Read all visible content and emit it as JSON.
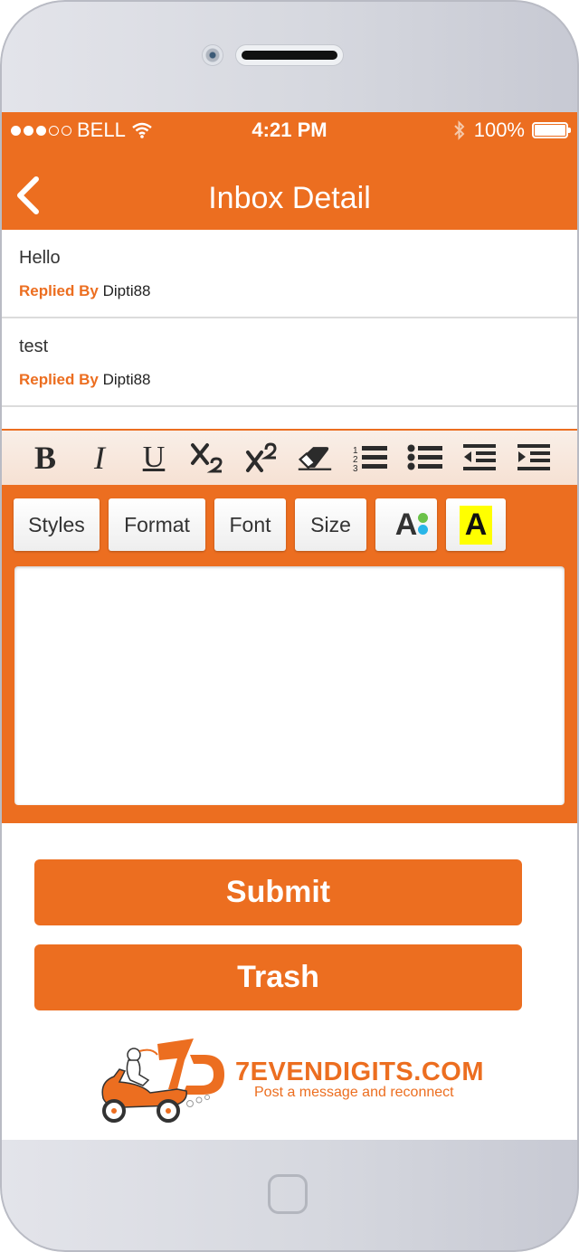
{
  "status": {
    "carrier": "BELL",
    "time": "4:21 PM",
    "battery": "100%"
  },
  "nav": {
    "title": "Inbox Detail"
  },
  "messages": [
    {
      "body": "Hello",
      "replied_label": "Replied By",
      "user": "Dipti88"
    },
    {
      "body": "test",
      "replied_label": "Replied By",
      "user": "Dipti88"
    }
  ],
  "toolbar": {
    "bold": "B",
    "italic": "I",
    "underline": "U"
  },
  "editor": {
    "styles": "Styles",
    "format": "Format",
    "font": "Font",
    "size": "Size",
    "text_color_glyph": "A",
    "bg_color_glyph": "A",
    "content": ""
  },
  "actions": {
    "submit": "Submit",
    "trash": "Trash"
  },
  "brand": {
    "name": "7EVENDIGITS.COM",
    "tagline": "Post a message and reconnect"
  },
  "colors": {
    "accent": "#ec6e20",
    "highlight": "#ffff00"
  }
}
